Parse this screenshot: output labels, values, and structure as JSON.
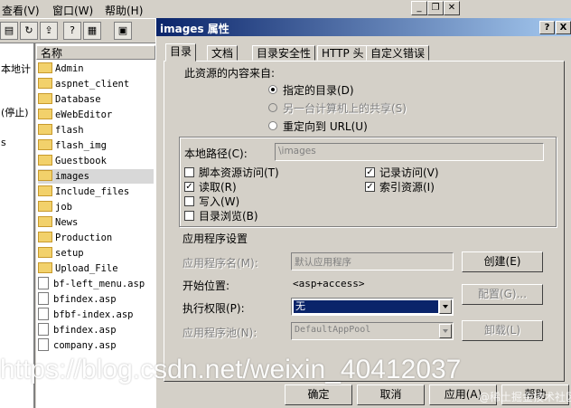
{
  "menubar": {
    "items": [
      "查看(V)",
      "窗口(W)",
      "帮助(H)"
    ]
  },
  "tree": {
    "items": [
      "本地计",
      "(停止)",
      "s"
    ]
  },
  "list": {
    "column_header": "名称",
    "items": [
      {
        "name": "Admin",
        "type": "folder"
      },
      {
        "name": "aspnet_client",
        "type": "folder"
      },
      {
        "name": "Database",
        "type": "folder"
      },
      {
        "name": "eWebEditor",
        "type": "folder"
      },
      {
        "name": "flash",
        "type": "folder"
      },
      {
        "name": "flash_img",
        "type": "folder"
      },
      {
        "name": "Guestbook",
        "type": "folder"
      },
      {
        "name": "images",
        "type": "folder",
        "selected": true
      },
      {
        "name": "Include_files",
        "type": "folder"
      },
      {
        "name": "job",
        "type": "folder"
      },
      {
        "name": "News",
        "type": "folder"
      },
      {
        "name": "Production",
        "type": "folder"
      },
      {
        "name": "setup",
        "type": "folder"
      },
      {
        "name": "Upload_File",
        "type": "folder"
      },
      {
        "name": "bf-left_menu.asp",
        "type": "file"
      },
      {
        "name": "bfindex.asp",
        "type": "file"
      },
      {
        "name": "bfbf-index.asp",
        "type": "file"
      },
      {
        "name": "bfindex.asp",
        "type": "file"
      },
      {
        "name": "company.asp",
        "type": "file"
      }
    ]
  },
  "dialog": {
    "title": "images 属性",
    "help_btn": "?",
    "close_btn": "X",
    "tabs": [
      "目录",
      "文档",
      "目录安全性",
      "HTTP 头",
      "自定义错误"
    ],
    "active_tab": 0,
    "content_source_label": "此资源的内容来自:",
    "radios": [
      {
        "label": "指定的目录(D)",
        "checked": true,
        "disabled": false
      },
      {
        "label": "另一台计算机上的共享(S)",
        "checked": false,
        "disabled": true
      },
      {
        "label": "重定向到 URL(U)",
        "checked": false,
        "disabled": false
      }
    ],
    "local_path_label": "本地路径(C):",
    "local_path_value": "\\images",
    "checkboxes_left": [
      {
        "label": "脚本资源访问(T)",
        "checked": false
      },
      {
        "label": "读取(R)",
        "checked": true
      },
      {
        "label": "写入(W)",
        "checked": false
      },
      {
        "label": "目录浏览(B)",
        "checked": false
      }
    ],
    "checkboxes_right": [
      {
        "label": "记录访问(V)",
        "checked": true
      },
      {
        "label": "索引资源(I)",
        "checked": true
      }
    ],
    "app_settings_label": "应用程序设置",
    "app_name_label": "应用程序名(M):",
    "app_name_value": "默认应用程序",
    "start_point_label": "开始位置:",
    "start_point_value": "<asp+access>",
    "exec_perm_label": "执行权限(P):",
    "exec_perm_value": "无",
    "app_pool_label": "应用程序池(N):",
    "app_pool_value": "DefaultAppPool",
    "create_btn": "创建(E)",
    "config_btn": "配置(G)...",
    "unload_btn": "卸载(L)",
    "ok_btn": "确定",
    "cancel_btn": "取消",
    "apply_btn": "应用(A)",
    "help_bottom_btn": "帮助"
  },
  "watermark": "https://blog.csdn.net/weixin_40412037",
  "watermark2": "@稀土掘金技术社区",
  "colors": {
    "title_start": "#0a246a",
    "title_end": "#a6caf0",
    "selection": "#0a246a",
    "face": "#d4d0c8"
  }
}
